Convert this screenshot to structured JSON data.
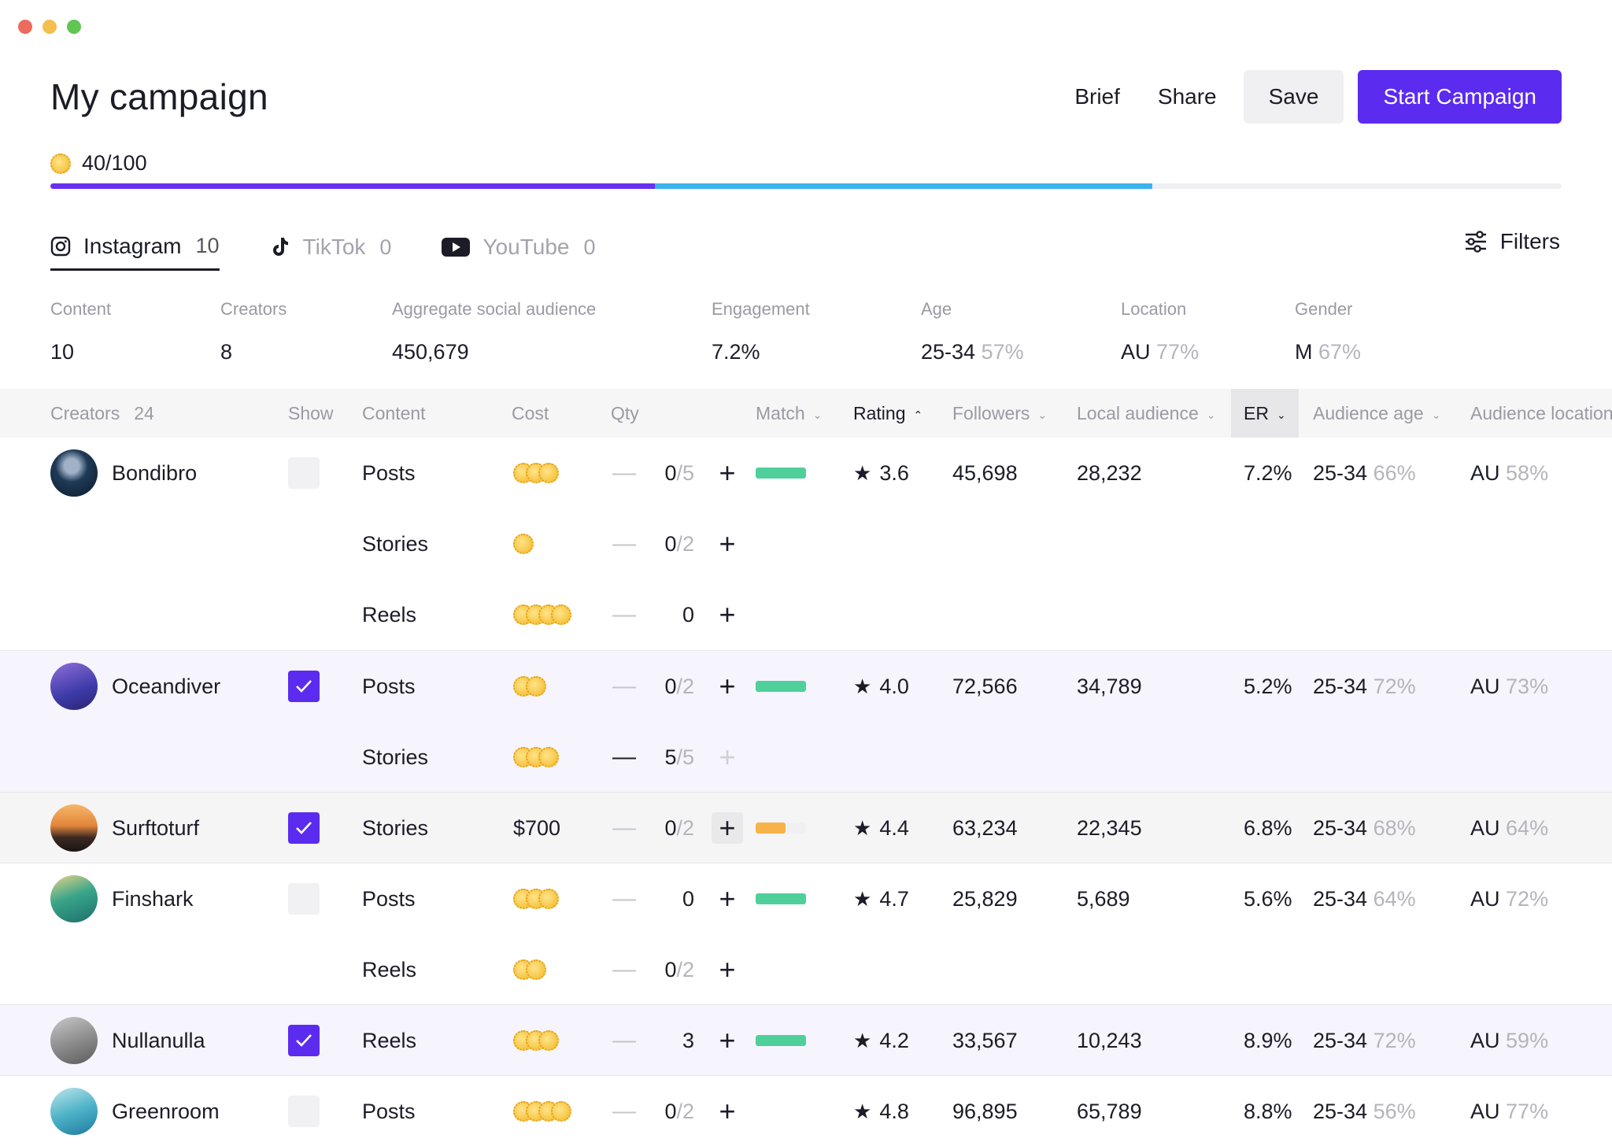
{
  "window": {
    "controls": [
      "close",
      "minimize",
      "zoom"
    ]
  },
  "page": {
    "title": "My campaign"
  },
  "toolbar": {
    "brief": "Brief",
    "share": "Share",
    "save": "Save",
    "start": "Start Campaign"
  },
  "credits": {
    "label": "40/100",
    "used_fraction": 0.4,
    "planned_fraction": 0.625
  },
  "colors": {
    "accent": "#5b2bf0",
    "progress_used": "#6a30f0",
    "progress_planned": "#3ab3ef",
    "match_green": "#4fd09a",
    "match_orange": "#f7b24a"
  },
  "tabs": [
    {
      "label": "Instagram",
      "count": "10",
      "icon": "instagram-icon",
      "active": true
    },
    {
      "label": "TikTok",
      "count": "0",
      "icon": "tiktok-icon",
      "active": false
    },
    {
      "label": "YouTube",
      "count": "0",
      "icon": "youtube-icon",
      "active": false
    }
  ],
  "filters": {
    "label": "Filters",
    "icon": "sliders-icon"
  },
  "stats": {
    "content": {
      "label": "Content",
      "value": "10"
    },
    "creators": {
      "label": "Creators",
      "value": "8"
    },
    "audience": {
      "label": "Aggregate social audience",
      "value": "450,679"
    },
    "engagement": {
      "label": "Engagement",
      "value": "7.2%"
    },
    "age": {
      "label": "Age",
      "value": "25-34",
      "pct": "57%"
    },
    "location": {
      "label": "Location",
      "value": "AU",
      "pct": "77%"
    },
    "gender": {
      "label": "Gender",
      "value": "M",
      "pct": "67%"
    }
  },
  "table": {
    "headers": {
      "creators": "Creators",
      "creators_count": "24",
      "show": "Show",
      "content": "Content",
      "cost": "Cost",
      "qty": "Qty",
      "match": "Match",
      "rating": "Rating",
      "followers": "Followers",
      "local": "Local audience",
      "er": "ER",
      "aud_age": "Audience age",
      "aud_loc": "Audience location"
    },
    "groups": [
      {
        "name": "Bondibro",
        "checked": false,
        "style": "plain",
        "rating": "3.6",
        "followers": "45,698",
        "local": "28,232",
        "er": "7.2%",
        "age": "25-34",
        "age_pct": "66%",
        "loc": "AU",
        "loc_pct": "58%",
        "match": 1.0,
        "match_color": "green",
        "rows": [
          {
            "content": "Posts",
            "coins": 3,
            "cost": "",
            "qty": "0",
            "qmax": "/5",
            "minus_active": false,
            "plus_disabled": false,
            "plus_boxed": false
          },
          {
            "content": "Stories",
            "coins": 1,
            "cost": "",
            "qty": "0",
            "qmax": "/2",
            "minus_active": false,
            "plus_disabled": false,
            "plus_boxed": false
          },
          {
            "content": "Reels",
            "coins": 4,
            "cost": "",
            "qty": "0",
            "qmax": "",
            "minus_active": false,
            "plus_disabled": false,
            "plus_boxed": false
          }
        ]
      },
      {
        "name": "Oceandiver",
        "checked": true,
        "style": "sel",
        "rating": "4.0",
        "followers": "72,566",
        "local": "34,789",
        "er": "5.2%",
        "age": "25-34",
        "age_pct": "72%",
        "loc": "AU",
        "loc_pct": "73%",
        "match": 1.0,
        "match_color": "green",
        "rows": [
          {
            "content": "Posts",
            "coins": 2,
            "cost": "",
            "qty": "0",
            "qmax": "/2",
            "minus_active": false,
            "plus_disabled": false,
            "plus_boxed": false
          },
          {
            "content": "Stories",
            "coins": 3,
            "cost": "",
            "qty": "5",
            "qmax": "/5",
            "minus_active": true,
            "plus_disabled": true,
            "plus_boxed": false
          }
        ]
      },
      {
        "name": "Surftoturf",
        "checked": true,
        "style": "hover",
        "rating": "4.4",
        "followers": "63,234",
        "local": "22,345",
        "er": "6.8%",
        "age": "25-34",
        "age_pct": "68%",
        "loc": "AU",
        "loc_pct": "64%",
        "match": 0.6,
        "match_color": "orange",
        "rows": [
          {
            "content": "Stories",
            "coins": 0,
            "cost": "$700",
            "qty": "0",
            "qmax": "/2",
            "minus_active": false,
            "plus_disabled": false,
            "plus_boxed": true
          }
        ]
      },
      {
        "name": "Finshark",
        "checked": false,
        "style": "plain",
        "rating": "4.7",
        "followers": "25,829",
        "local": "5,689",
        "er": "5.6%",
        "age": "25-34",
        "age_pct": "64%",
        "loc": "AU",
        "loc_pct": "72%",
        "match": 1.0,
        "match_color": "green",
        "rows": [
          {
            "content": "Posts",
            "coins": 3,
            "cost": "",
            "qty": "0",
            "qmax": "",
            "minus_active": false,
            "plus_disabled": false,
            "plus_boxed": false
          },
          {
            "content": "Reels",
            "coins": 2,
            "cost": "",
            "qty": "0",
            "qmax": "/2",
            "minus_active": false,
            "plus_disabled": false,
            "plus_boxed": false
          }
        ]
      },
      {
        "name": "Nullanulla",
        "checked": true,
        "style": "sel",
        "rating": "4.2",
        "followers": "33,567",
        "local": "10,243",
        "er": "8.9%",
        "age": "25-34",
        "age_pct": "72%",
        "loc": "AU",
        "loc_pct": "59%",
        "match": 1.0,
        "match_color": "green",
        "rows": [
          {
            "content": "Reels",
            "coins": 3,
            "cost": "",
            "qty": "3",
            "qmax": "",
            "minus_active": false,
            "plus_disabled": false,
            "plus_boxed": false
          }
        ]
      },
      {
        "name": "Greenroom",
        "checked": false,
        "style": "plain",
        "rating": "4.8",
        "followers": "96,895",
        "local": "65,789",
        "er": "8.8%",
        "age": "25-34",
        "age_pct": "56%",
        "loc": "AU",
        "loc_pct": "77%",
        "match": 0,
        "match_color": "none",
        "rows": [
          {
            "content": "Posts",
            "coins": 4,
            "cost": "",
            "qty": "0",
            "qmax": "/2",
            "minus_active": false,
            "plus_disabled": false,
            "plus_boxed": false
          }
        ]
      }
    ]
  }
}
